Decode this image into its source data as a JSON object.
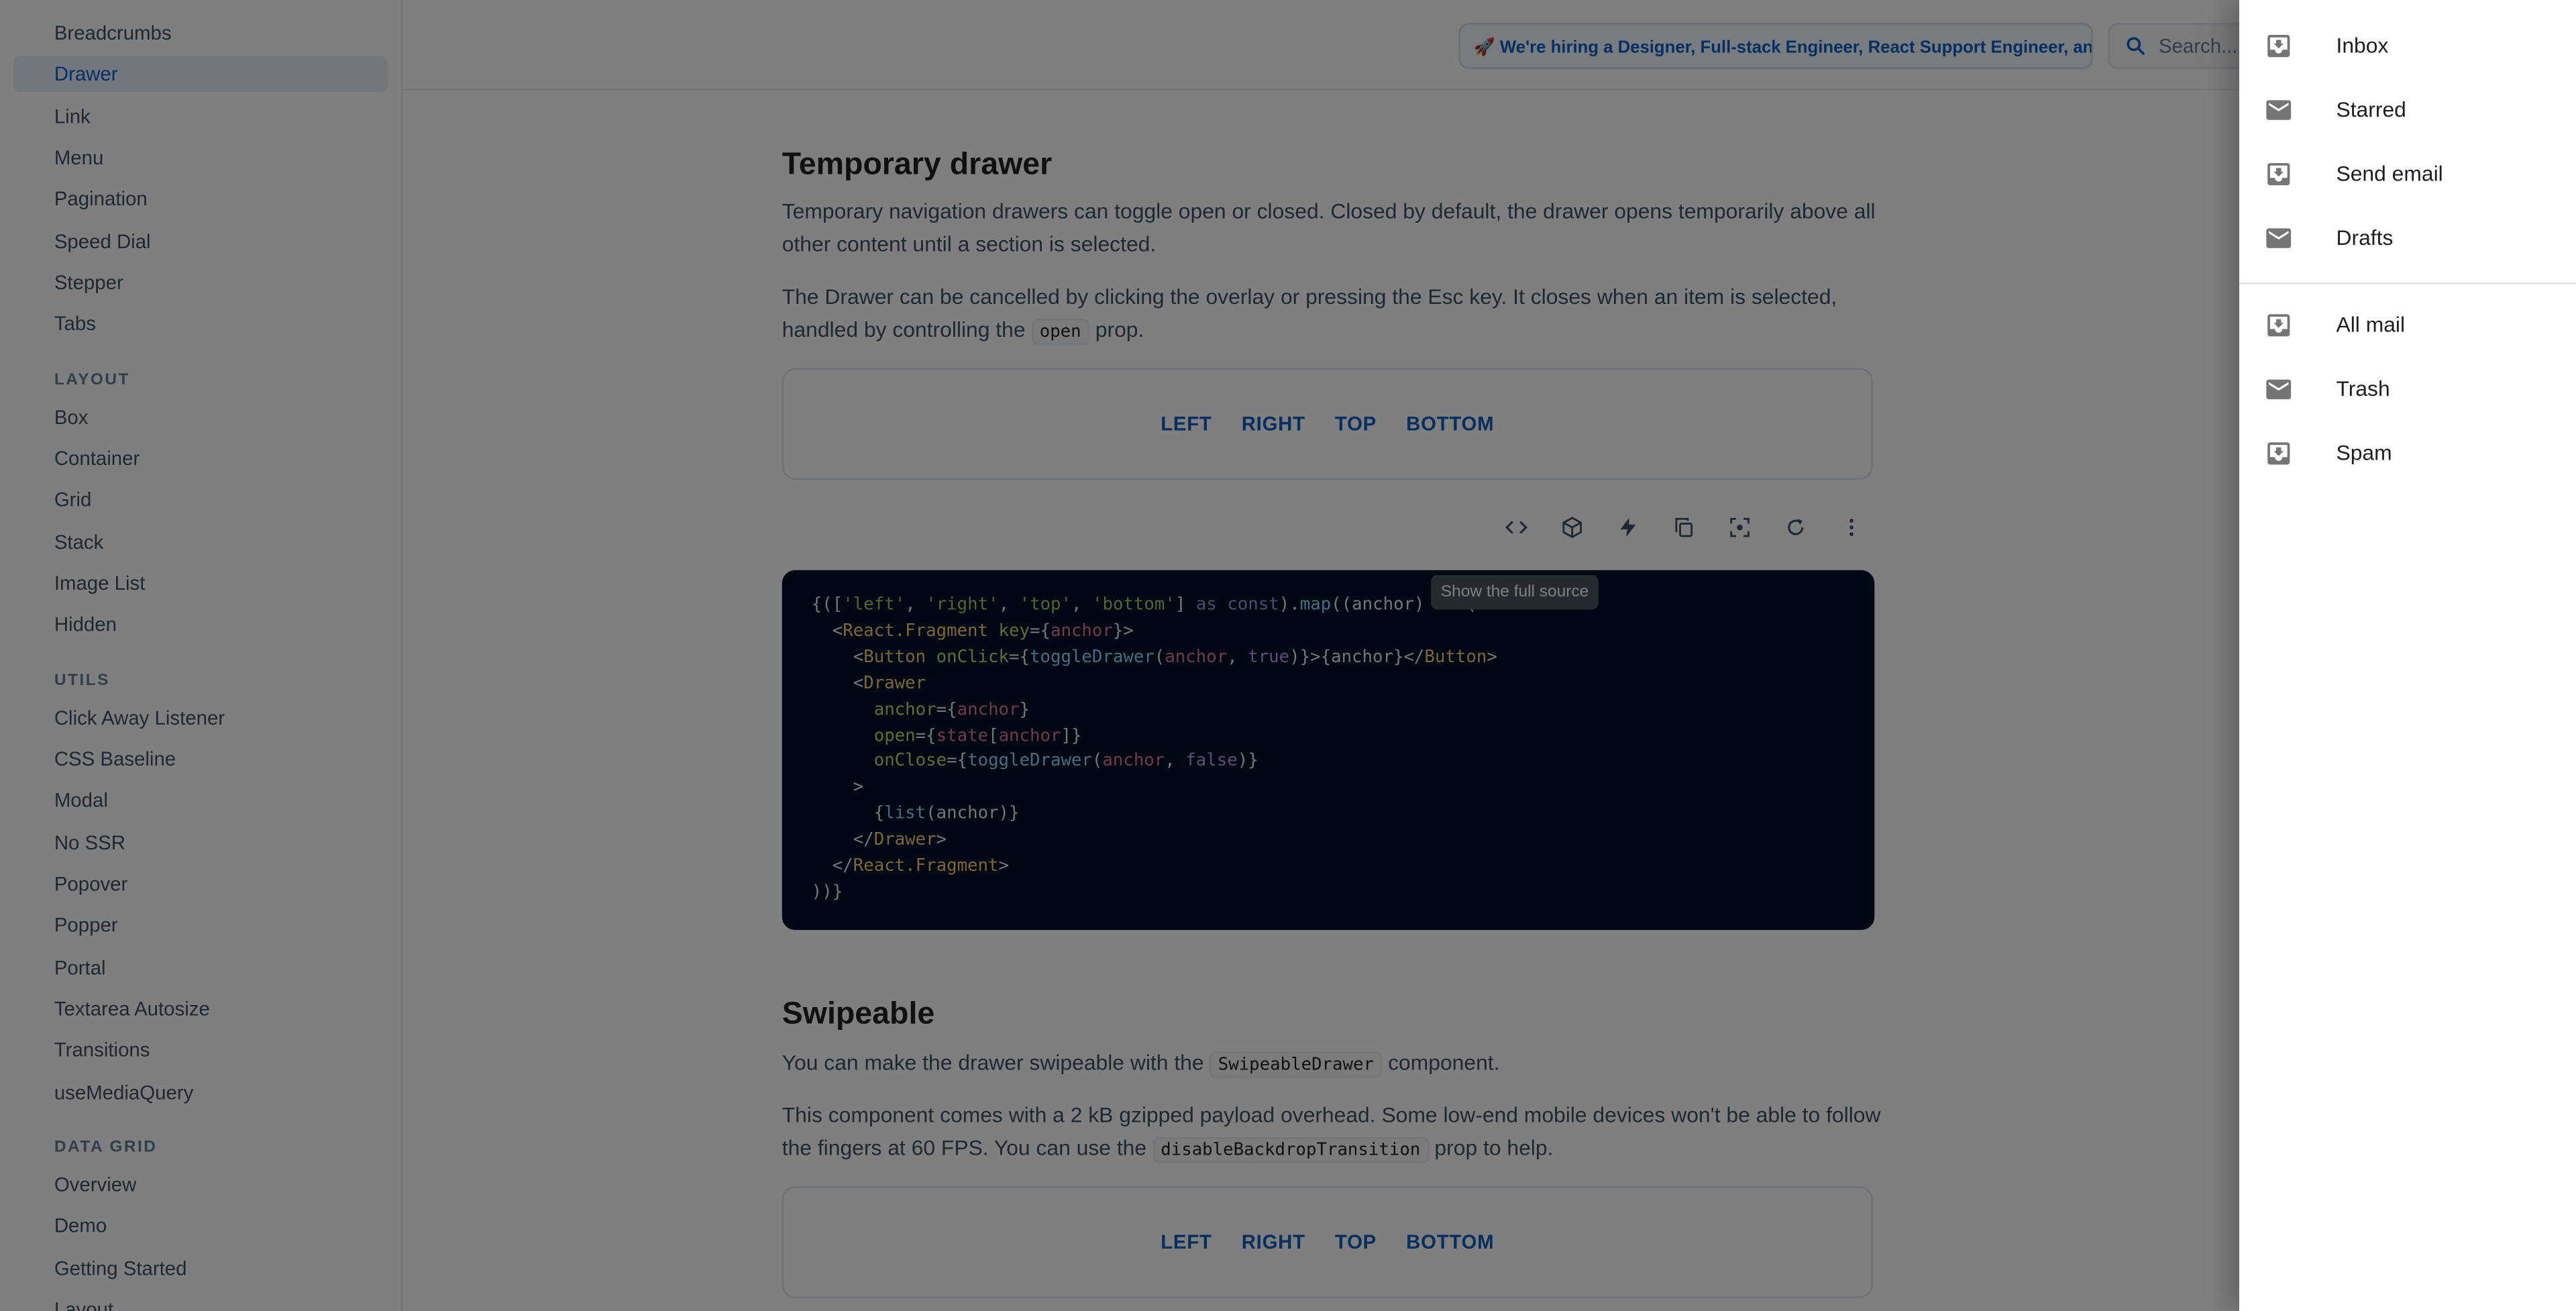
{
  "sidebar": {
    "items_top": [
      "Breadcrumbs",
      "Drawer",
      "Link",
      "Menu",
      "Pagination",
      "Speed Dial",
      "Stepper",
      "Tabs"
    ],
    "section_layout": "LAYOUT",
    "items_layout": [
      "Box",
      "Container",
      "Grid",
      "Stack",
      "Image List",
      "Hidden"
    ],
    "section_utils": "UTILS",
    "items_utils": [
      "Click Away Listener",
      "CSS Baseline",
      "Modal",
      "No SSR",
      "Popover",
      "Popper",
      "Portal",
      "Textarea Autosize",
      "Transitions",
      "useMediaQuery"
    ],
    "section_data_grid": "DATA GRID",
    "items_data_grid": [
      "Overview",
      "Demo",
      "Getting Started",
      "Layout"
    ],
    "active": "Drawer"
  },
  "appbar": {
    "hiring_banner": "🚀 We're hiring a Designer, Full-stack Engineer, React Support Engineer, and more!",
    "search_placeholder": "Search..."
  },
  "temporary": {
    "title": "Temporary drawer",
    "p1": "Temporary navigation drawers can toggle open or closed. Closed by default, the drawer opens temporarily above all other content until a section is selected.",
    "p2_before": "The Drawer can be cancelled by clicking the overlay or pressing the Esc key. It closes when an item is selected, handled by controlling the",
    "p2_code": "open",
    "p2_after": "prop.",
    "buttons": [
      "LEFT",
      "RIGHT",
      "TOP",
      "BOTTOM"
    ]
  },
  "toolbar": {
    "icons": [
      "code-icon",
      "sandbox-icon",
      "bolt-icon",
      "copy-icon",
      "reset-focus-icon",
      "refresh-icon",
      "more-icon"
    ],
    "tooltip": "Show the full source"
  },
  "code": {
    "lines": [
      "{(['left', 'right', 'top', 'bottom'] as const).map((anchor) => (",
      "  <React.Fragment key={anchor}>",
      "    <Button onClick={toggleDrawer(anchor, true)}>{anchor}</Button>",
      "    <Drawer",
      "      anchor={anchor}",
      "      open={state[anchor]}",
      "      onClose={toggleDrawer(anchor, false)}",
      "    >",
      "      {list(anchor)}",
      "    </Drawer>",
      "  </React.Fragment>",
      "))}"
    ]
  },
  "swipeable": {
    "title": "Swipeable",
    "p1_before": "You can make the drawer swipeable with the",
    "p1_code": "SwipeableDrawer",
    "p1_after": "component.",
    "p2_before": "This component comes with a 2 kB gzipped payload overhead. Some low-end mobile devices won't be able to follow the fingers at 60 FPS. You can use the",
    "p2_code": "disableBackdropTransition",
    "p2_after": "prop to help.",
    "buttons": [
      "LEFT",
      "RIGHT",
      "TOP",
      "BOTTOM"
    ]
  },
  "drawer": {
    "group1": [
      {
        "label": "Inbox",
        "icon": "inbox-icon"
      },
      {
        "label": "Starred",
        "icon": "mail-icon"
      },
      {
        "label": "Send email",
        "icon": "inbox-icon"
      },
      {
        "label": "Drafts",
        "icon": "mail-icon"
      }
    ],
    "group2": [
      {
        "label": "All mail",
        "icon": "inbox-icon"
      },
      {
        "label": "Trash",
        "icon": "mail-icon"
      },
      {
        "label": "Spam",
        "icon": "inbox-icon"
      }
    ]
  },
  "colors": {
    "primary": "#0a5dc2",
    "code_bg": "#001226",
    "backdrop": "rgba(0,0,0,0.5)"
  }
}
